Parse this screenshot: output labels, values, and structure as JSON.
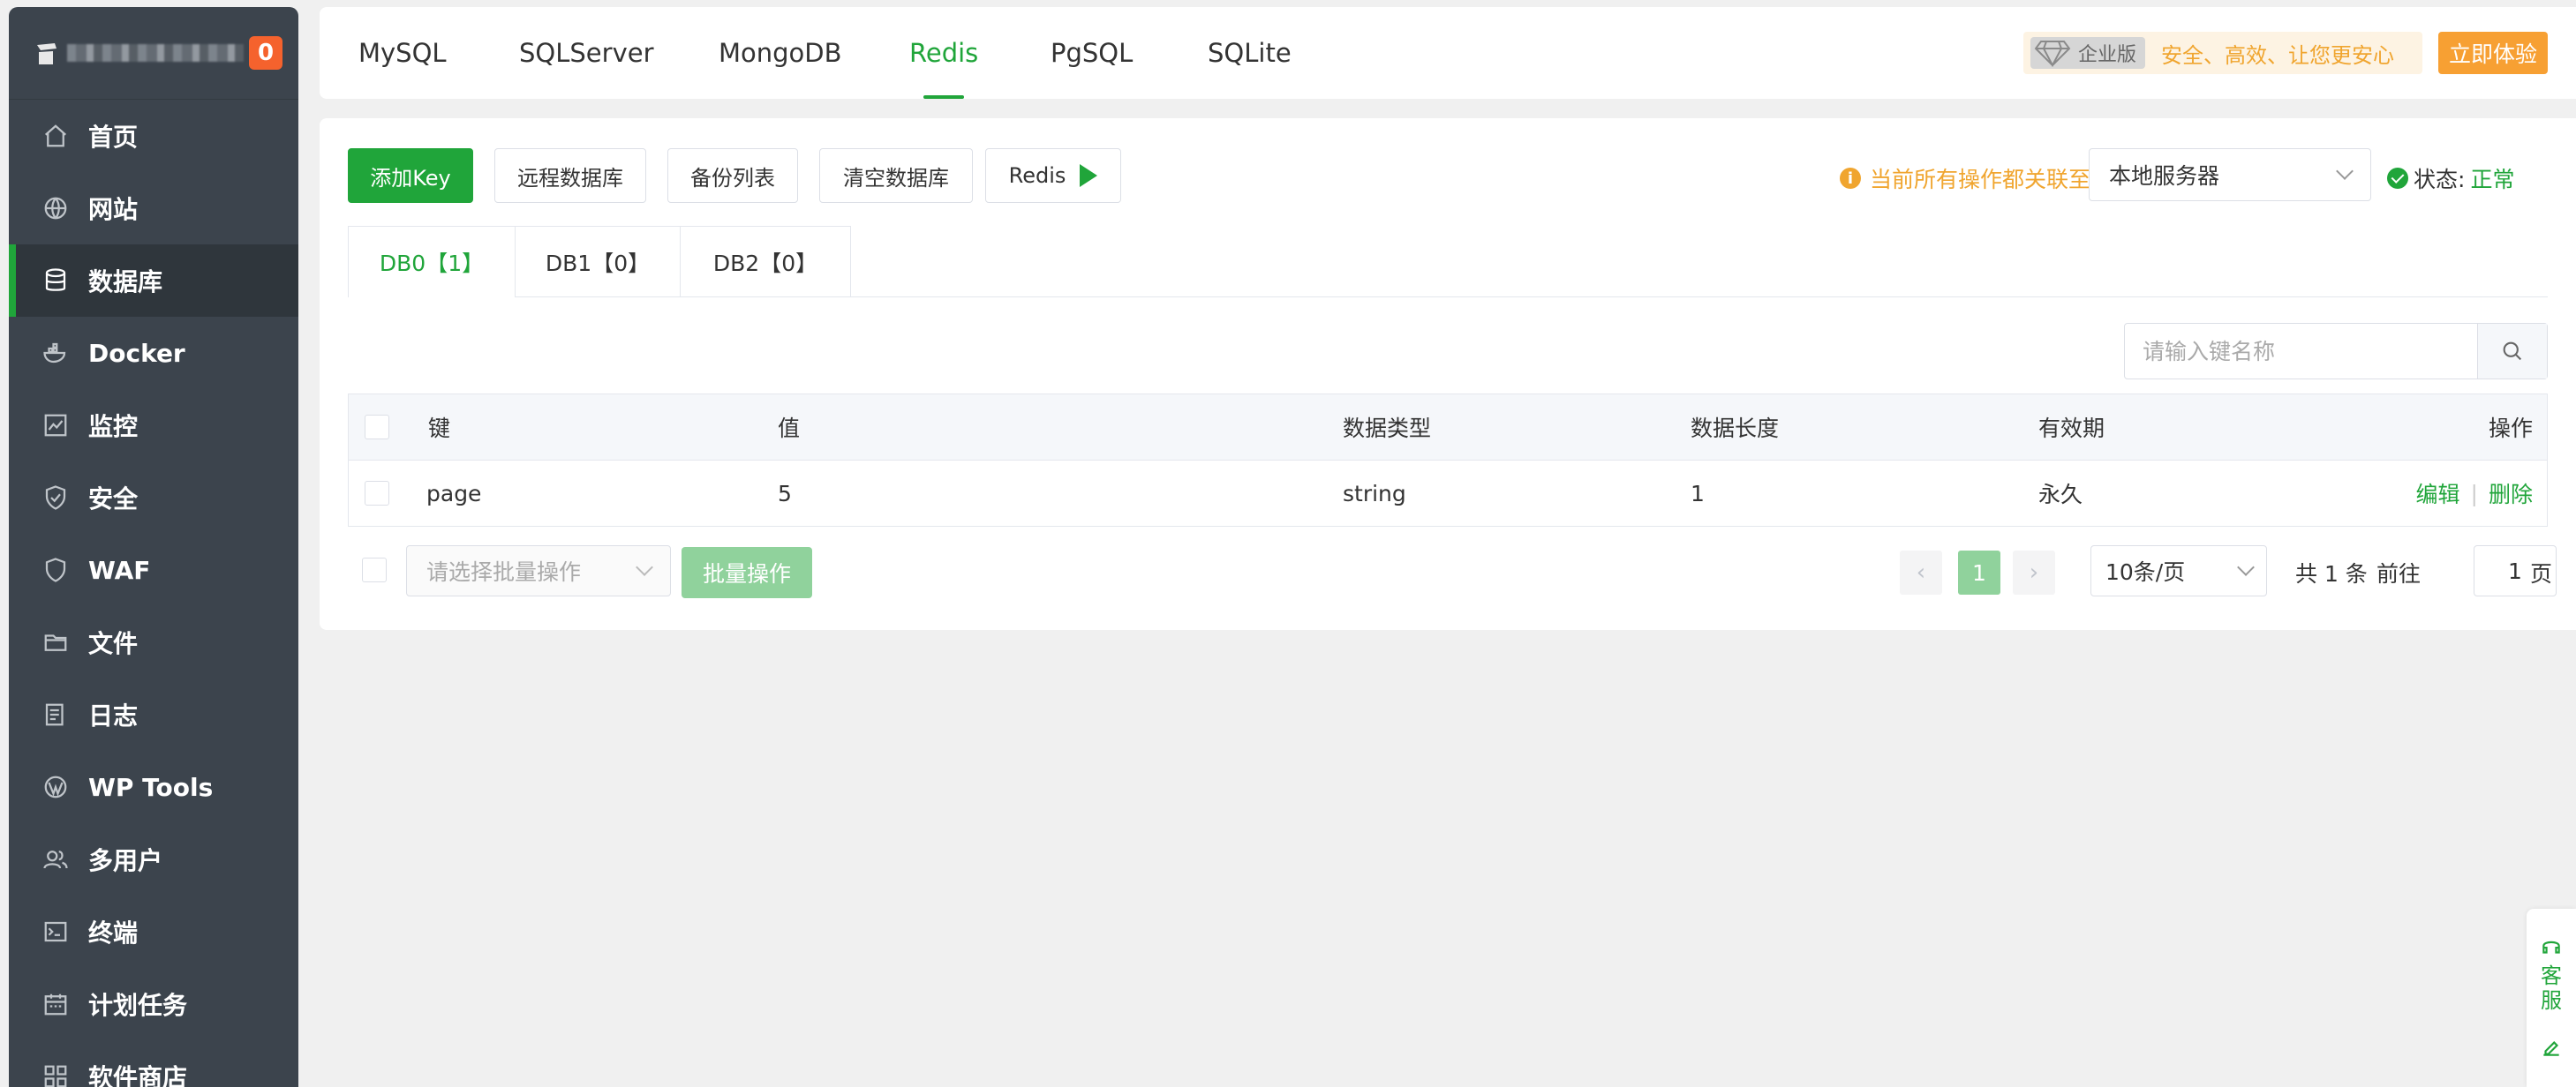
{
  "sidebar": {
    "badge": "0",
    "items": [
      {
        "label": "首页",
        "icon": "home-icon"
      },
      {
        "label": "网站",
        "icon": "globe-icon"
      },
      {
        "label": "数据库",
        "icon": "database-icon",
        "active": true
      },
      {
        "label": "Docker",
        "icon": "docker-icon"
      },
      {
        "label": "监控",
        "icon": "monitor-icon"
      },
      {
        "label": "安全",
        "icon": "shield-icon"
      },
      {
        "label": "WAF",
        "icon": "waf-icon"
      },
      {
        "label": "文件",
        "icon": "folder-icon"
      },
      {
        "label": "日志",
        "icon": "log-icon"
      },
      {
        "label": "WP Tools",
        "icon": "wordpress-icon"
      },
      {
        "label": "多用户",
        "icon": "users-icon"
      },
      {
        "label": "终端",
        "icon": "terminal-icon"
      },
      {
        "label": "计划任务",
        "icon": "calendar-icon"
      },
      {
        "label": "软件商店",
        "icon": "apps-icon"
      }
    ]
  },
  "topbar": {
    "tabs": [
      "MySQL",
      "SQLServer",
      "MongoDB",
      "Redis",
      "PgSQL",
      "SQLite"
    ],
    "active_tab": "Redis",
    "enterprise_label": "企业版",
    "enterprise_slogan": "安全、高效、让您更安心",
    "trial_button": "立即体验"
  },
  "toolbar": {
    "add_key": "添加Key",
    "remote_db": "远程数据库",
    "backup_list": "备份列表",
    "clear_db": "清空数据库",
    "redis_cli": "Redis",
    "notice": "当前所有操作都关联至",
    "server": "本地服务器",
    "status_label": "状态:",
    "status_value": "正常"
  },
  "db_tabs": [
    "DB0【1】",
    "DB1【0】",
    "DB2【0】"
  ],
  "search": {
    "placeholder": "请输入键名称"
  },
  "table": {
    "headers": {
      "key": "键",
      "value": "值",
      "type": "数据类型",
      "length": "数据长度",
      "ttl": "有效期",
      "actions": "操作"
    },
    "rows": [
      {
        "key": "page",
        "value": "5",
        "type": "string",
        "length": "1",
        "ttl": "永久",
        "edit": "编辑",
        "delete": "删除"
      }
    ]
  },
  "footer": {
    "bulk_placeholder": "请选择批量操作",
    "bulk_button": "批量操作",
    "current_page": "1",
    "page_size": "10条/页",
    "total": "共 1 条",
    "goto_label": "前往",
    "goto_value": "1",
    "page_suffix": "页"
  },
  "service": {
    "label": "客服"
  },
  "colors": {
    "brand": "#20a53a",
    "warning": "#f0a52f",
    "sidebar": "#3c444d",
    "badge": "#f5622d"
  }
}
